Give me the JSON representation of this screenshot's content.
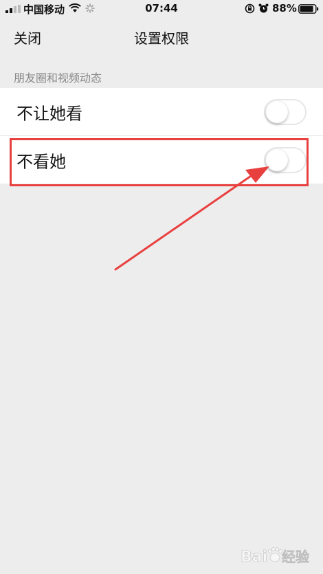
{
  "status_bar": {
    "carrier": "中国移动",
    "time": "07:44",
    "battery": "88%",
    "signal_icon": "signal-icon",
    "wifi_icon": "wifi-icon",
    "activity_icon": "spinner-icon",
    "rotation_icon": "rotation-lock-icon",
    "alarm_icon": "alarm-icon",
    "battery_icon": "battery-icon"
  },
  "nav": {
    "close_label": "关闭",
    "title": "设置权限"
  },
  "section": {
    "header": "朋友圈和视频动态",
    "items": [
      {
        "label": "不让她看",
        "toggle_on": false
      },
      {
        "label": "不看她",
        "toggle_on": false
      }
    ]
  },
  "annotation": {
    "color": "#e8403f",
    "target_item_index": 1
  },
  "watermark": {
    "text": "Bai经验"
  },
  "colors": {
    "background": "#ededed",
    "list_background": "#ffffff",
    "section_text": "#888888"
  }
}
